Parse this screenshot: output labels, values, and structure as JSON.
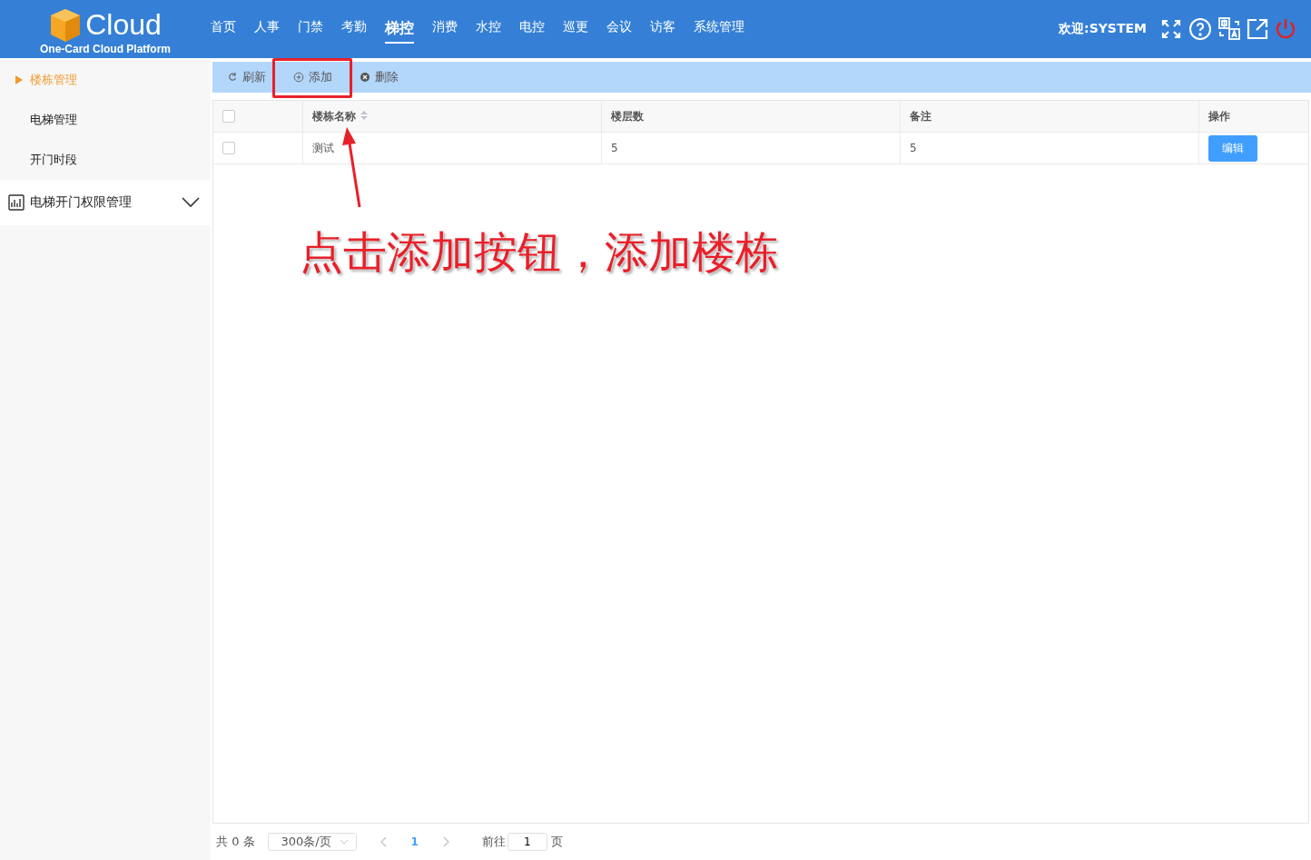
{
  "header": {
    "logo_text": "Cloud",
    "subtitle": "One-Card Cloud Platform",
    "nav": [
      {
        "label": "首页",
        "selected": false
      },
      {
        "label": "人事",
        "selected": false
      },
      {
        "label": "门禁",
        "selected": false
      },
      {
        "label": "考勤",
        "selected": false
      },
      {
        "label": "梯控",
        "selected": true
      },
      {
        "label": "消费",
        "selected": false
      },
      {
        "label": "水控",
        "selected": false
      },
      {
        "label": "电控",
        "selected": false
      },
      {
        "label": "巡更",
        "selected": false
      },
      {
        "label": "会议",
        "selected": false
      },
      {
        "label": "访客",
        "selected": false
      },
      {
        "label": "系统管理",
        "selected": false
      }
    ],
    "welcome": "欢迎:SYSTEM"
  },
  "sidebar": {
    "items": [
      {
        "label": "楼栋管理",
        "selected": true
      },
      {
        "label": "电梯管理",
        "selected": false
      },
      {
        "label": "开门时段",
        "selected": false
      }
    ],
    "groups": [
      {
        "label": "电梯开门权限管理",
        "expanded": false
      }
    ]
  },
  "toolbar": [
    {
      "label": "刷新",
      "kind": "refresh"
    },
    {
      "label": "添加",
      "kind": "add"
    },
    {
      "label": "删除",
      "kind": "delete"
    }
  ],
  "table": {
    "all_checked": false,
    "columns": [
      {
        "label": "楼栋名称",
        "sortable": true
      },
      {
        "label": "楼层数",
        "sortable": false
      },
      {
        "label": "备注",
        "sortable": false
      },
      {
        "label": "操作",
        "sortable": false
      }
    ],
    "rows": [
      {
        "checked": false,
        "cells": [
          "测试",
          "5",
          "5"
        ],
        "action": "编辑"
      }
    ]
  },
  "pagination": {
    "total": "共 0 条",
    "page_size": "300条/页",
    "current_page": "1",
    "goto_label": "前往",
    "goto_value": "1",
    "page_suffix": "页"
  },
  "annotation": {
    "text": "点击添加按钮，添加楼栋"
  }
}
